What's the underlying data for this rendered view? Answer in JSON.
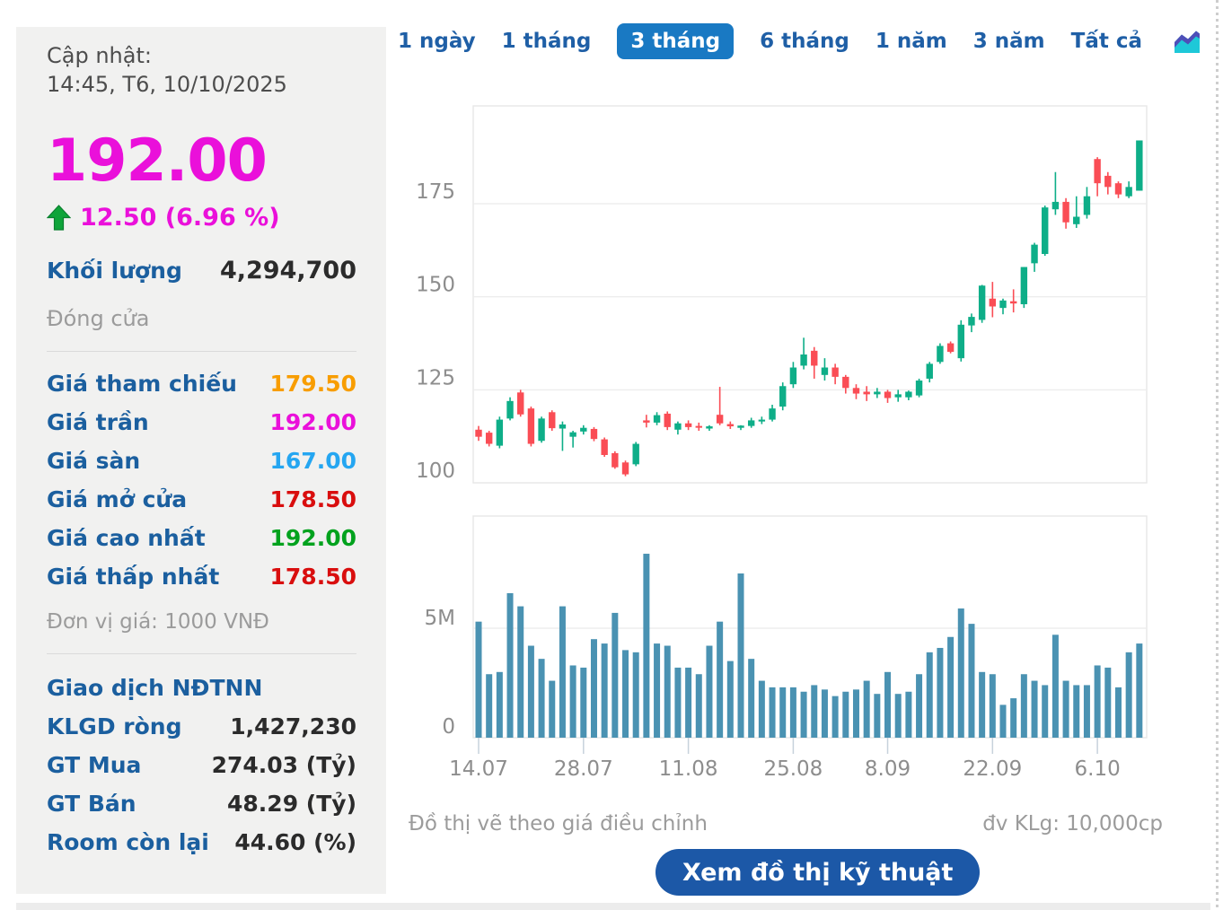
{
  "sidebar": {
    "updated_label": "Cập nhật:",
    "updated_time": "14:45, T6, 10/10/2025",
    "price": "192.00",
    "change": "12.50 (6.96 %)",
    "volume_label": "Khối lượng",
    "volume_value": "4,294,700",
    "session_status": "Đóng cửa",
    "price_rows": [
      {
        "label": "Giá tham chiếu",
        "value": "179.50",
        "color": "#F89D00"
      },
      {
        "label": "Giá trần",
        "value": "192.00",
        "color": "#EA10DA"
      },
      {
        "label": "Giá sàn",
        "value": "167.00",
        "color": "#25A6F1"
      },
      {
        "label": "Giá mở cửa",
        "value": "178.50",
        "color": "#D90E0E"
      },
      {
        "label": "Giá cao nhất",
        "value": "192.00",
        "color": "#00A21D"
      },
      {
        "label": "Giá thấp nhất",
        "value": "178.50",
        "color": "#D90E0E"
      }
    ],
    "price_unit": "Đơn vị giá: 1000 VNĐ",
    "foreign_header": "Giao dịch NĐTNN",
    "foreign_rows": [
      {
        "label": "KLGD ròng",
        "value": "1,427,230"
      },
      {
        "label": "GT Mua",
        "value": "274.03 (Tỷ)"
      },
      {
        "label": "GT Bán",
        "value": "48.29 (Tỷ)"
      },
      {
        "label": "Room còn lại",
        "value": "44.60 (%)"
      }
    ]
  },
  "tabs": {
    "items": [
      "1 ngày",
      "1 tháng",
      "3 tháng",
      "6 tháng",
      "1 năm",
      "3 năm",
      "Tất cả"
    ],
    "selected": "3 tháng",
    "chart_icon": "area-chart-icon"
  },
  "footer": {
    "note_left": "Đồ thị vẽ theo giá điều chỉnh",
    "note_right": "đv KLg: 10,000cp",
    "button": "Xem đồ thị kỹ thuật"
  },
  "colors": {
    "price_magenta": "#EA10DA",
    "candle_up": "#0EAE88",
    "candle_down": "#FA4D55",
    "volume_bar": "#4A92B2",
    "tab_selected_bg": "#1979C3",
    "tab_text": "#1F5FA6",
    "label_blue": "#1B5F9F",
    "button_bg": "#1C58A7",
    "arrow_green": "#0FA439",
    "value_orange": "#F89D00",
    "value_cyan": "#25A6F1",
    "value_red": "#D90E0E",
    "value_green": "#00A21D",
    "axis_text": "#8d8d8d",
    "gridline": "#ededed"
  },
  "chart_data": {
    "type": "candlestick_with_volume",
    "title": "",
    "xlabel": "",
    "ylabel": "",
    "price_axis": {
      "ticks": [
        100,
        125,
        150,
        175
      ],
      "range": [
        98,
        201
      ],
      "unit": "1000 VND"
    },
    "volume_axis": {
      "ticks": [
        "0",
        "5M"
      ],
      "range_m": [
        0,
        10
      ],
      "unit": "10,000cp"
    },
    "x_tick_labels": [
      "14.07",
      "28.07",
      "11.08",
      "25.08",
      "8.09",
      "22.09",
      "6.10"
    ],
    "x_tick_indices": [
      0,
      10,
      20,
      30,
      39,
      49,
      59
    ],
    "legend": "none",
    "grid": "horizontal",
    "candles_ohlc": [
      [
        114.3,
        115.3,
        111.3,
        112.4
      ],
      [
        113.5,
        114.0,
        109.8,
        110.5
      ],
      [
        110.0,
        117.8,
        109.3,
        117.0
      ],
      [
        117.3,
        123.0,
        116.8,
        122.0
      ],
      [
        124.3,
        125.0,
        117.8,
        118.4
      ],
      [
        120.0,
        120.5,
        109.8,
        110.5
      ],
      [
        111.3,
        117.8,
        110.8,
        117.3
      ],
      [
        119.0,
        119.5,
        114.0,
        114.7
      ],
      [
        114.6,
        116.5,
        108.6,
        115.7
      ],
      [
        112.4,
        114.0,
        109.5,
        113.6
      ],
      [
        113.8,
        115.5,
        113.0,
        114.8
      ],
      [
        114.5,
        115.0,
        111.2,
        111.8
      ],
      [
        111.7,
        112.2,
        107.0,
        107.5
      ],
      [
        108.0,
        108.5,
        103.8,
        104.2
      ],
      [
        105.5,
        106.0,
        101.8,
        102.3
      ],
      [
        105.0,
        111.0,
        104.5,
        110.5
      ],
      [
        116.8,
        118.3,
        114.9,
        116.2
      ],
      [
        116.2,
        119.0,
        115.5,
        118.2
      ],
      [
        118.6,
        119.2,
        114.2,
        115.0
      ],
      [
        114.3,
        116.5,
        113.0,
        116.0
      ],
      [
        116.0,
        116.8,
        114.2,
        115.0
      ],
      [
        115.3,
        116.2,
        114.0,
        114.9
      ],
      [
        114.6,
        115.5,
        114.0,
        115.2
      ],
      [
        118.3,
        125.8,
        115.5,
        116.0
      ],
      [
        115.8,
        116.5,
        114.5,
        115.2
      ],
      [
        114.8,
        115.5,
        114.2,
        115.4
      ],
      [
        115.3,
        117.5,
        114.8,
        116.8
      ],
      [
        116.5,
        117.8,
        115.8,
        117.0
      ],
      [
        117.0,
        121.0,
        116.5,
        120.0
      ],
      [
        120.5,
        127.0,
        119.5,
        126.0
      ],
      [
        126.5,
        132.5,
        125.5,
        131.0
      ],
      [
        131.5,
        139.0,
        130.5,
        134.5
      ],
      [
        135.5,
        136.5,
        128.0,
        131.5
      ],
      [
        129.0,
        133.5,
        127.5,
        131.0
      ],
      [
        131.0,
        132.0,
        126.5,
        128.5
      ],
      [
        128.5,
        129.0,
        124.0,
        125.5
      ],
      [
        125.5,
        126.5,
        122.5,
        124.0
      ],
      [
        124.5,
        126.0,
        122.0,
        123.8
      ],
      [
        123.8,
        125.5,
        122.8,
        124.5
      ],
      [
        124.5,
        125.0,
        121.5,
        122.8
      ],
      [
        123.0,
        125.0,
        121.8,
        123.8
      ],
      [
        123.0,
        124.8,
        122.2,
        124.5
      ],
      [
        123.5,
        128.0,
        123.0,
        127.5
      ],
      [
        128.0,
        132.5,
        127.0,
        132.0
      ],
      [
        132.5,
        137.5,
        132.0,
        136.8
      ],
      [
        137.5,
        138.0,
        134.8,
        135.2
      ],
      [
        133.5,
        143.7,
        132.6,
        142.5
      ],
      [
        142.3,
        145.5,
        140.5,
        144.6
      ],
      [
        143.8,
        153.2,
        143.0,
        153.0
      ],
      [
        149.5,
        154.0,
        144.5,
        147.4
      ],
      [
        147.0,
        149.5,
        145.3,
        149.0
      ],
      [
        148.8,
        152.0,
        145.8,
        148.2
      ],
      [
        148.0,
        158.0,
        147.0,
        158.0
      ],
      [
        159.0,
        164.5,
        156.7,
        164.0
      ],
      [
        161.5,
        174.5,
        161.0,
        174.0
      ],
      [
        173.5,
        183.5,
        172.0,
        175.5
      ],
      [
        175.5,
        176.5,
        168.3,
        170.0
      ],
      [
        169.5,
        177.0,
        168.5,
        171.5
      ],
      [
        172.0,
        179.5,
        171.0,
        177.0
      ],
      [
        187.0,
        187.5,
        177.0,
        180.5
      ],
      [
        182.5,
        183.5,
        177.5,
        179.5
      ],
      [
        180.5,
        181.0,
        176.5,
        177.5
      ],
      [
        177.0,
        181.0,
        176.5,
        179.5
      ],
      [
        178.5,
        192.0,
        178.5,
        192.0
      ]
    ],
    "volumes_m": [
      5.3,
      2.9,
      3.0,
      6.6,
      6.0,
      4.2,
      3.6,
      2.6,
      6.0,
      3.3,
      3.2,
      4.5,
      4.3,
      5.7,
      4.0,
      3.9,
      8.4,
      4.3,
      4.2,
      3.2,
      3.2,
      2.9,
      4.2,
      5.3,
      3.5,
      7.5,
      3.6,
      2.6,
      2.3,
      2.3,
      2.3,
      2.1,
      2.4,
      2.2,
      1.9,
      2.1,
      2.2,
      2.6,
      2.0,
      3.0,
      2.0,
      2.1,
      2.9,
      3.9,
      4.1,
      4.6,
      5.9,
      5.2,
      3.0,
      2.9,
      1.5,
      1.8,
      2.9,
      2.6,
      2.4,
      4.7,
      2.6,
      2.4,
      2.4,
      3.3,
      3.2,
      2.3,
      3.9,
      4.3
    ]
  }
}
